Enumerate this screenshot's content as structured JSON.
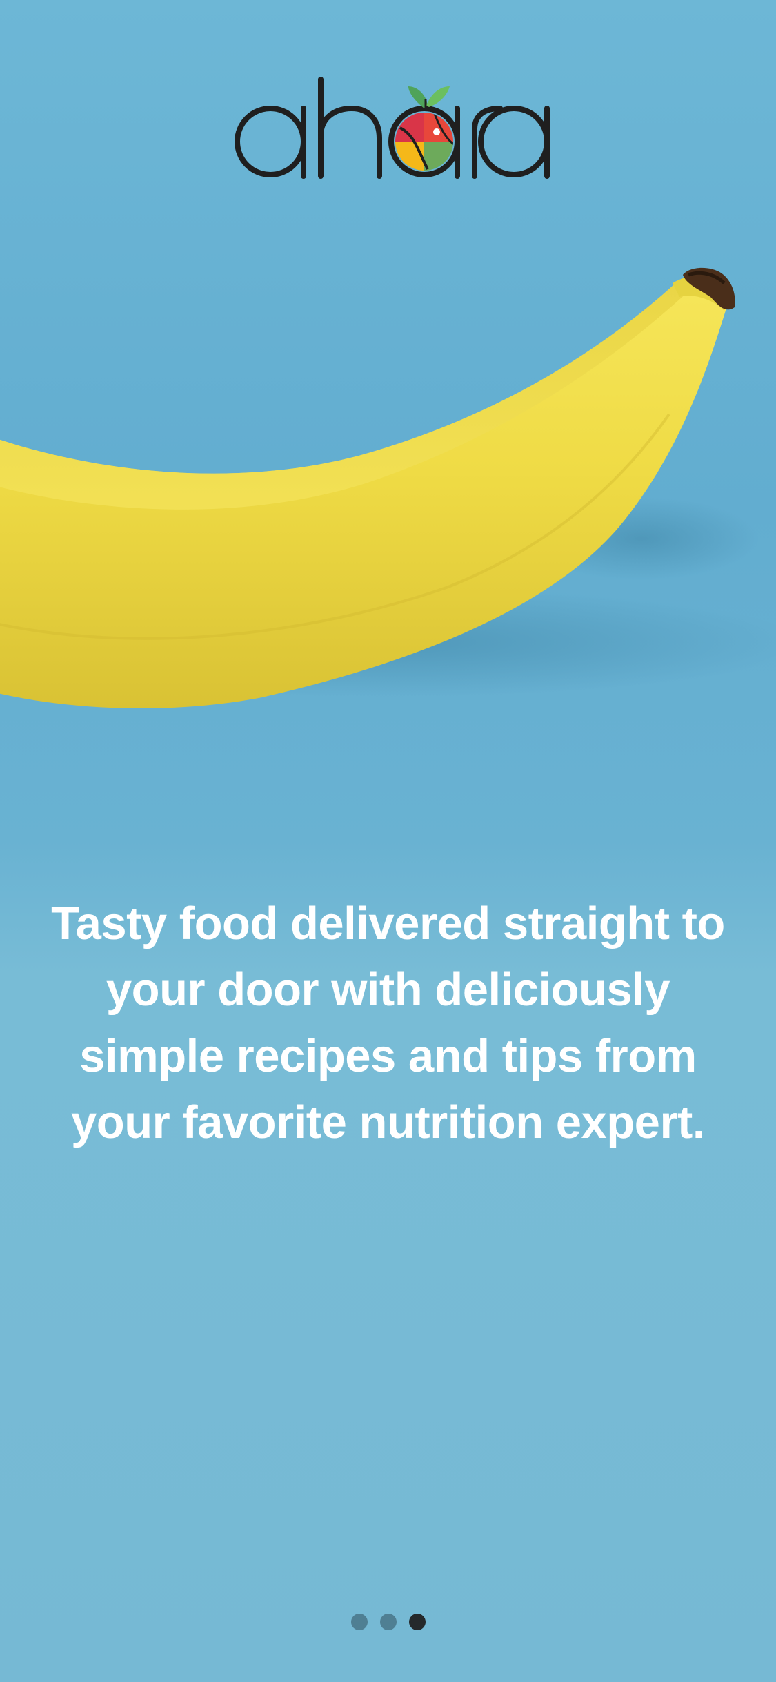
{
  "brand": {
    "name": "ahara"
  },
  "onboarding": {
    "caption": "Tasty food delivered straight to your door with deliciously simple recipes and tips from your favorite nutrition expert.",
    "image": "banana-photo",
    "pager": {
      "total": 3,
      "current": 3
    }
  },
  "colors": {
    "background": "#76B9D4",
    "banana": "#F2E04A",
    "text": "#FFFFFF",
    "dot_inactive": "#4F7F93",
    "dot_active": "#25292B"
  }
}
